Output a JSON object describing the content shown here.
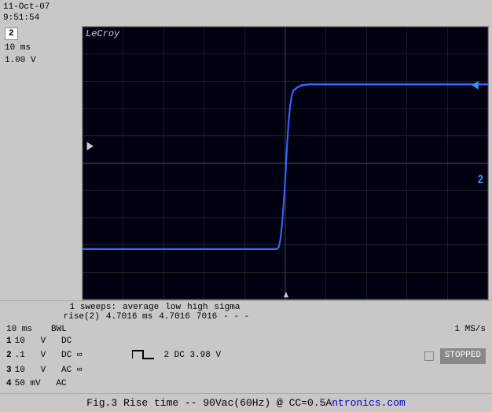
{
  "timestamp": {
    "date": "11-Oct-07",
    "time": "9:51:54"
  },
  "lecroy": "LeCroy",
  "channel": {
    "badge": "2",
    "time_div": "10 ms",
    "volt_div": "1.00 V"
  },
  "markers": {
    "left_arrow": "►",
    "right_arrow": "◄",
    "ch2_label": "2",
    "bottom_arrow": "▼"
  },
  "measurements": {
    "sweeps": "1 sweeps:",
    "average_label": "average",
    "low_label": "low",
    "high_label": "high",
    "sigma_label": "sigma",
    "param_label": "rise(2)",
    "average_val": "4.7016 ms",
    "low_val": "4.7016",
    "high_val": "7016",
    "high_prefix": "high ",
    "high_full": "high 7016",
    "sigma_val": "- - -"
  },
  "status": {
    "row1": {
      "time_div": "10 ms",
      "bwl": "BWL"
    },
    "channels": [
      {
        "num": "1",
        "volt": "10",
        "unit": "V",
        "coupling": "DC"
      },
      {
        "num": "2",
        "volt": ".1",
        "unit": "V",
        "coupling": "DC",
        "bw": "∞"
      },
      {
        "num": "3",
        "volt": "10",
        "unit": "V",
        "coupling": "AC",
        "bw": "∞"
      },
      {
        "num": "4",
        "volt": "50 mV",
        "unit": "",
        "coupling": "AC"
      }
    ],
    "ch2_info": "2 DC 3.98 V",
    "sample_rate": "1 MS/s",
    "stopped": "STOPPED"
  },
  "caption": {
    "text": "Fig.3  Rise time  --  90Vac(60Hz) @  CC=0.5A",
    "suffix": "ntronics.com"
  }
}
